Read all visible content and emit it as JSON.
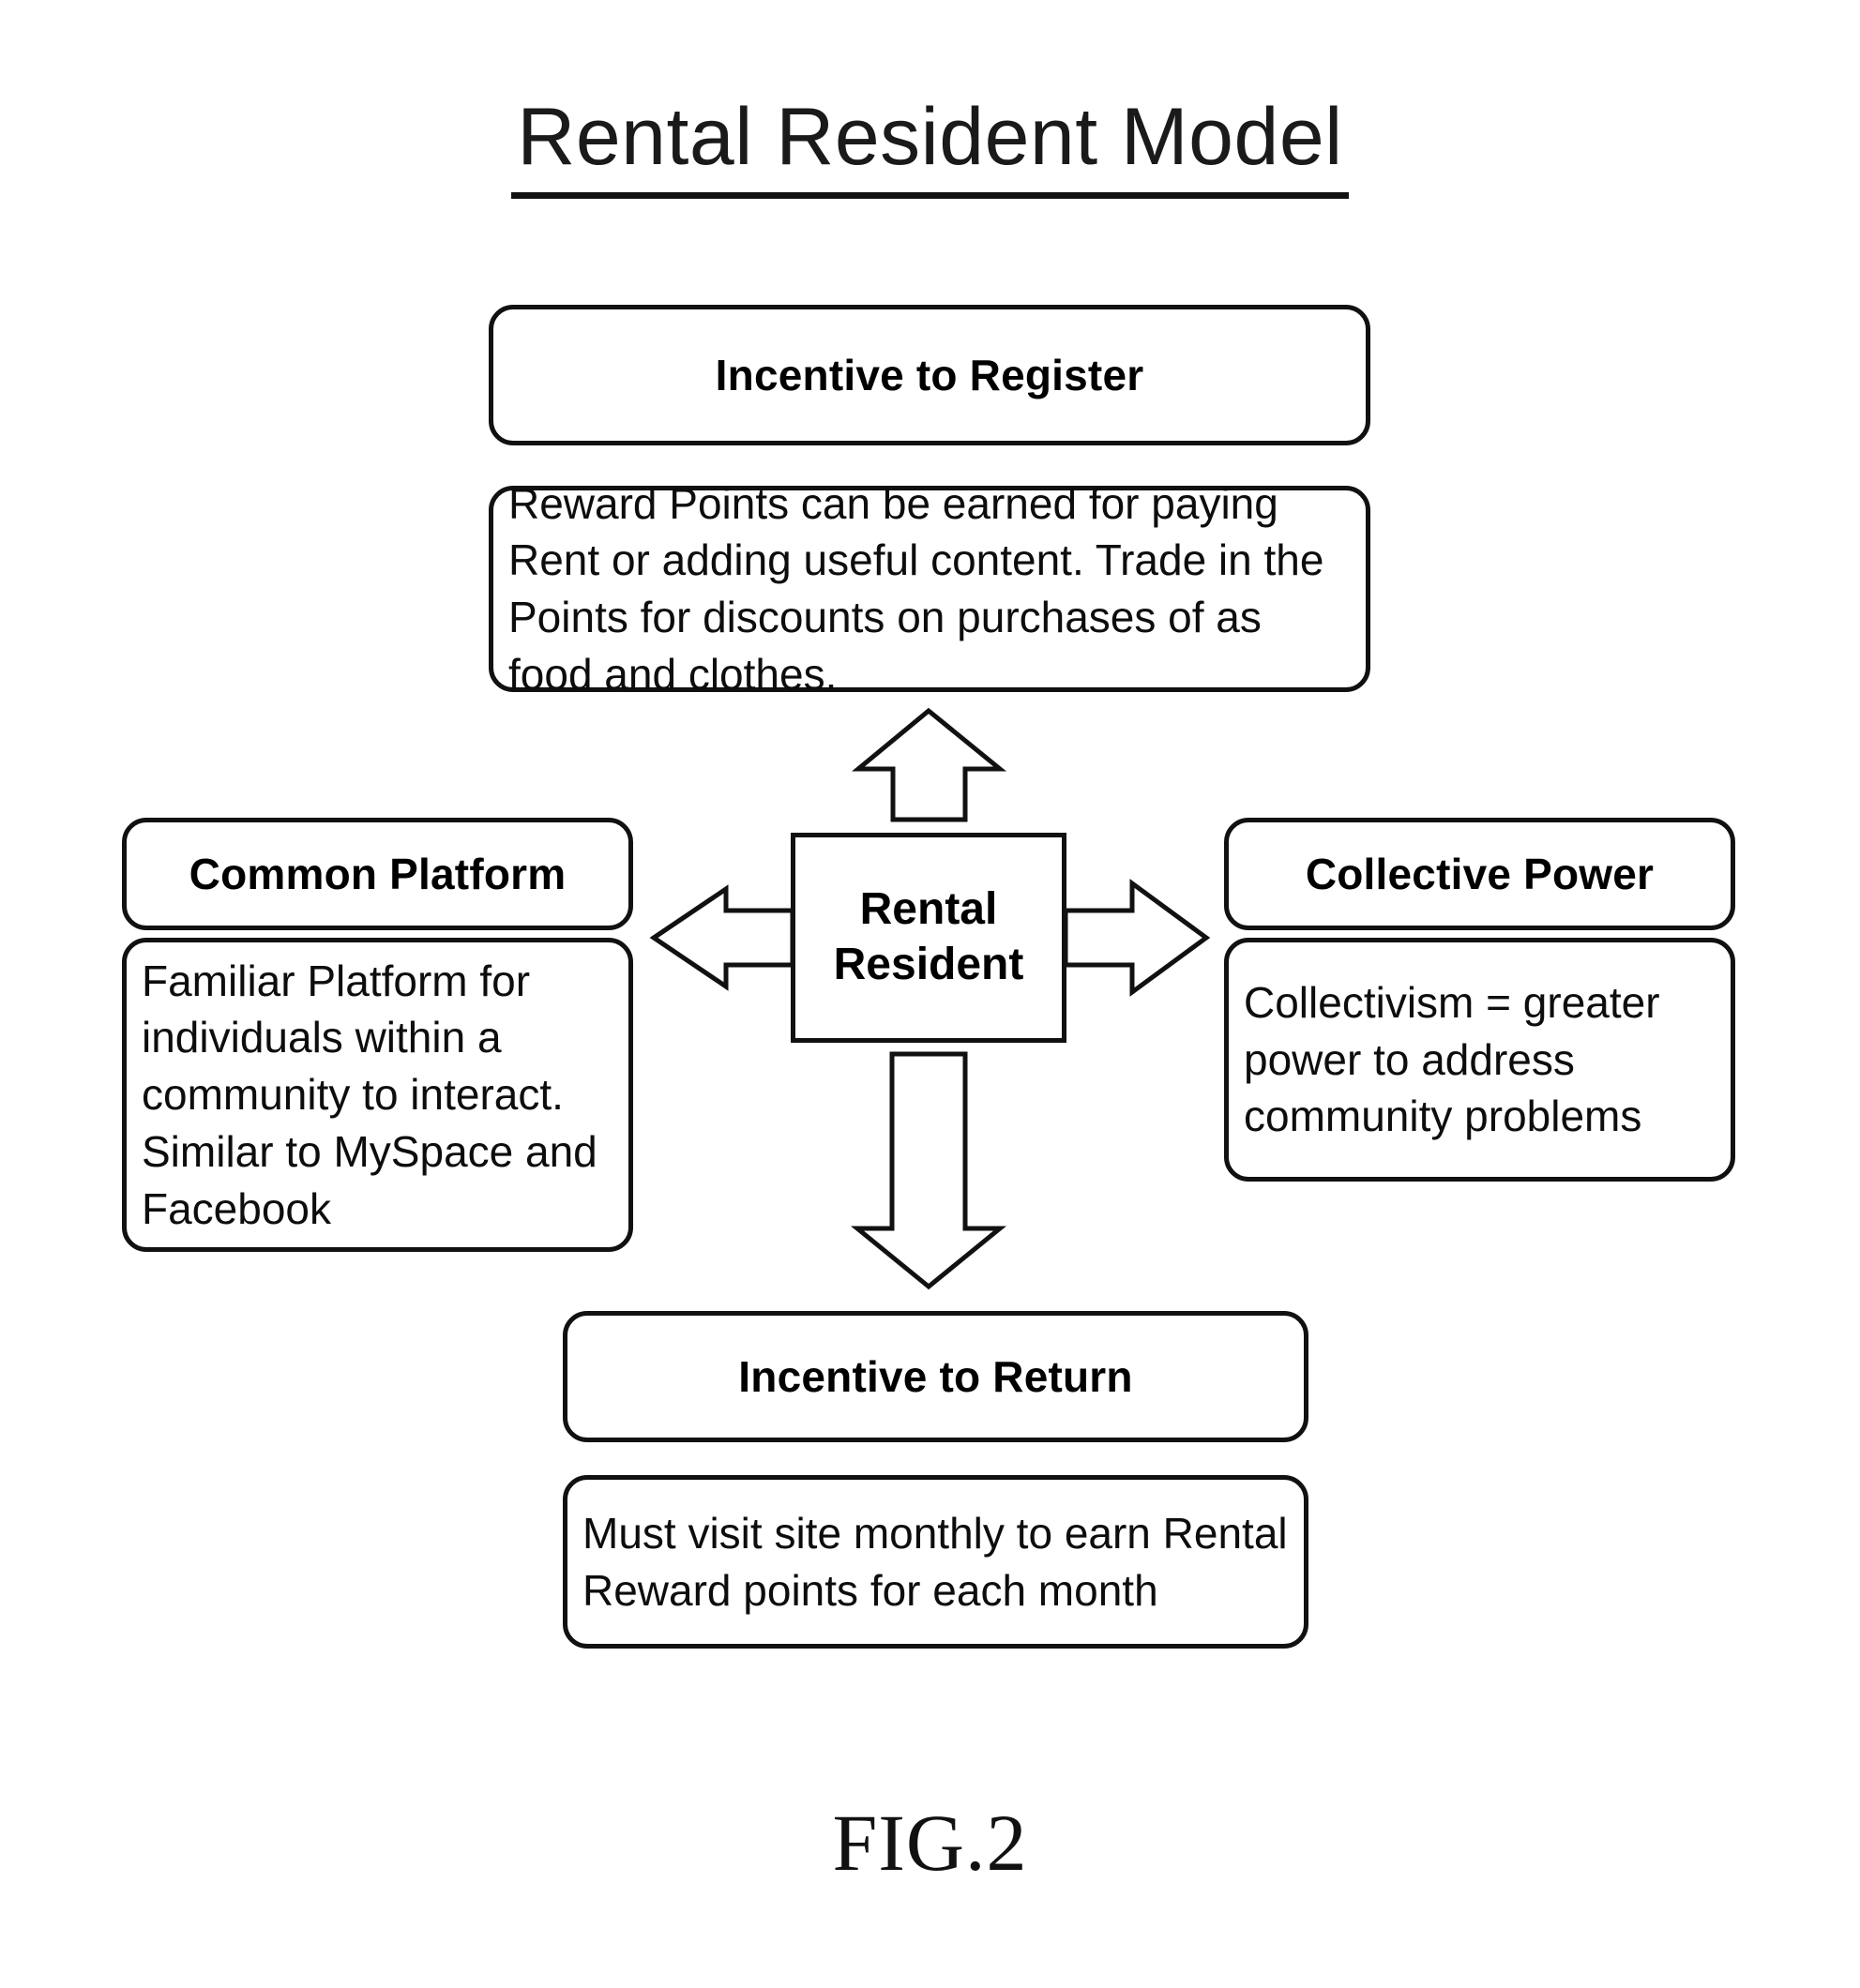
{
  "figure": {
    "title": "Rental Resident Model",
    "caption": "FIG.2"
  },
  "hub": {
    "label_line1": "Rental",
    "label_line2": "Resident"
  },
  "nodes": {
    "top": {
      "title": "Incentive to Register",
      "body": "Reward Points can be earned for paying Rent or adding useful content. Trade in the Points for discounts on purchases of as food and clothes."
    },
    "left": {
      "title": "Common Platform",
      "body": "Familiar Platform for individuals within a community to interact. Similar to MySpace and Facebook"
    },
    "right": {
      "title": "Collective Power",
      "body": "Collectivism = greater power to address community problems"
    },
    "bottom": {
      "title": "Incentive to Return",
      "body": "Must visit site monthly to earn Rental Reward points for each month"
    }
  },
  "arrows": {
    "up": "arrow-up-icon",
    "down": "arrow-down-icon",
    "left": "arrow-left-icon",
    "right": "arrow-right-icon"
  },
  "style": {
    "ink": "#111111",
    "paper": "#ffffff"
  }
}
